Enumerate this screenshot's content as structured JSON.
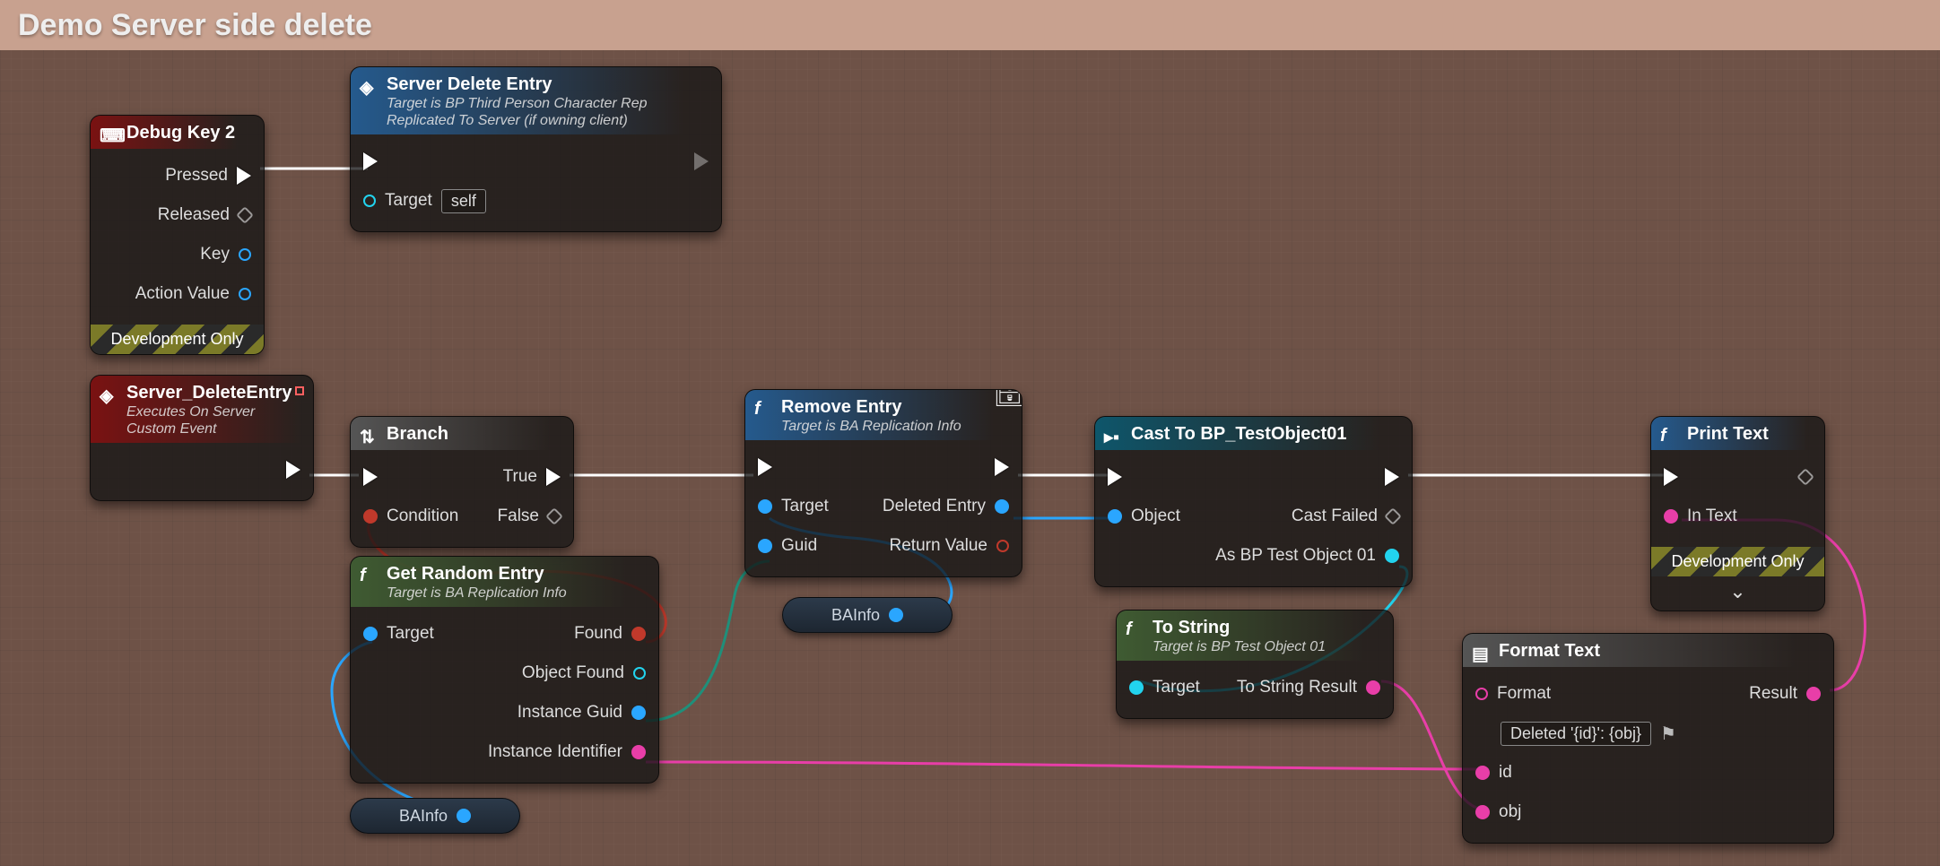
{
  "banner": {
    "title": "Demo Server side delete"
  },
  "labels": {
    "devOnly": "Development Only"
  },
  "pills": {
    "baInfo": "BAInfo"
  },
  "nodes": {
    "debugKey": {
      "title": "Debug Key 2",
      "out": {
        "pressed": "Pressed",
        "released": "Released",
        "key": "Key",
        "actionValue": "Action Value"
      }
    },
    "serverDeleteCall": {
      "title": "Server Delete Entry",
      "sub1": "Target is BP Third Person Character Rep",
      "sub2": "Replicated To Server (if owning client)",
      "in": {
        "target": "Target",
        "targetVal": "self"
      }
    },
    "serverEvent": {
      "title": "Server_DeleteEntry",
      "sub1": "Executes On Server",
      "sub2": "Custom Event"
    },
    "branch": {
      "title": "Branch",
      "in": {
        "cond": "Condition"
      },
      "out": {
        "t": "True",
        "f": "False"
      }
    },
    "getRandom": {
      "title": "Get Random Entry",
      "sub": "Target is BA Replication Info",
      "in": {
        "target": "Target"
      },
      "out": {
        "found": "Found",
        "objectFound": "Object Found",
        "instanceGuid": "Instance Guid",
        "instanceIdentifier": "Instance Identifier"
      }
    },
    "removeEntry": {
      "title": "Remove Entry",
      "sub": "Target is BA Replication Info",
      "in": {
        "target": "Target",
        "guid": "Guid"
      },
      "out": {
        "deletedEntry": "Deleted Entry",
        "returnValue": "Return Value"
      }
    },
    "cast": {
      "title": "Cast To BP_TestObject01",
      "in": {
        "object": "Object"
      },
      "out": {
        "castFailed": "Cast Failed",
        "asObj": "As BP Test Object 01"
      }
    },
    "toString": {
      "title": "To String",
      "sub": "Target is BP Test Object 01",
      "in": {
        "target": "Target"
      },
      "out": {
        "result": "To String Result"
      }
    },
    "format": {
      "title": "Format Text",
      "in": {
        "format": "Format",
        "formatVal": "Deleted '{id}': {obj}",
        "id": "id",
        "obj": "obj"
      },
      "out": {
        "result": "Result"
      }
    },
    "printText": {
      "title": "Print Text",
      "in": {
        "inText": "In Text"
      }
    }
  }
}
